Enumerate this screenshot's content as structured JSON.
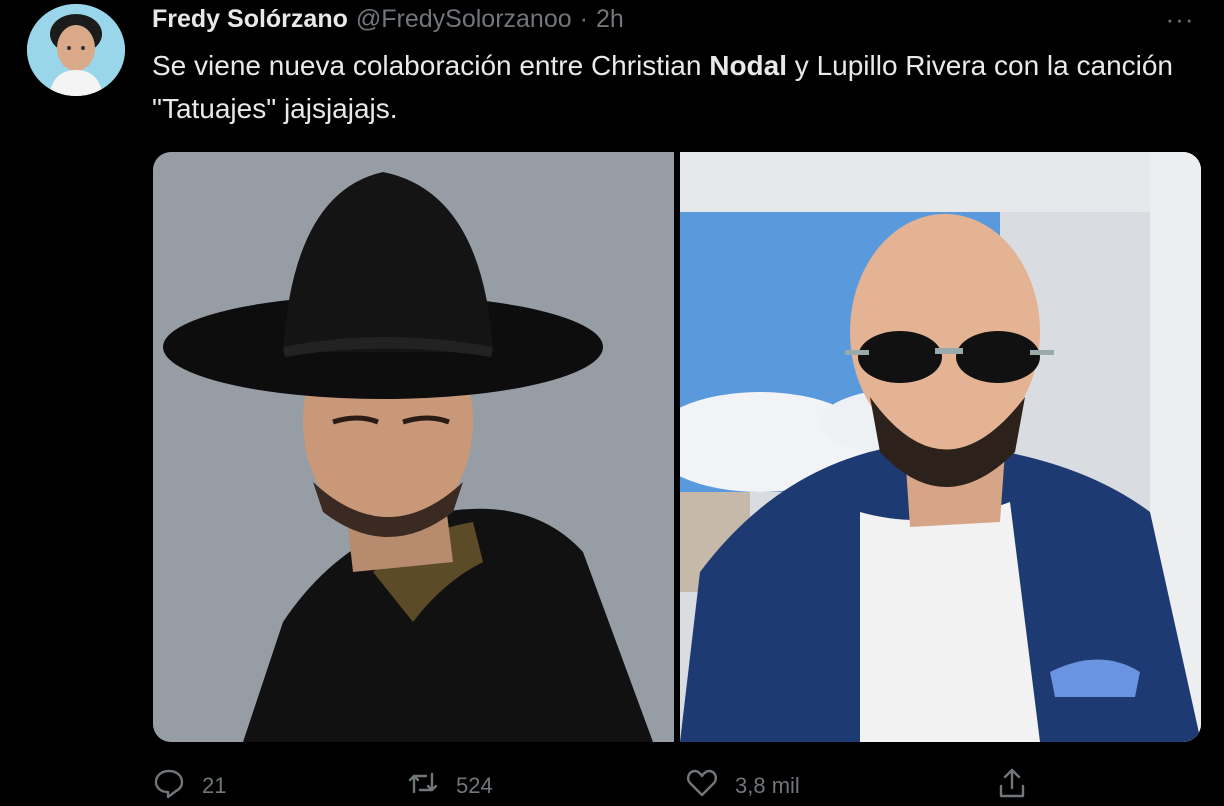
{
  "tweet": {
    "author_name": "Fredy Solórzano",
    "handle": "@FredySolorzanoo",
    "separator": "·",
    "time": "2h",
    "more_label": "···",
    "text_part1": "Se viene nueva colaboración entre Christian ",
    "text_bold": "Nodal",
    "text_part2": " y Lupillo Rivera con la canción \"Tatuajes\" jajsjajajs."
  },
  "actions": {
    "reply_count": "21",
    "retweet_count": "524",
    "like_count": "3,8 mil"
  },
  "icons": {
    "avatar": "avatar-image",
    "reply": "reply-icon",
    "retweet": "retweet-icon",
    "like": "heart-icon",
    "share": "share-icon",
    "more": "more-icon"
  },
  "colors": {
    "background": "#000000",
    "text": "#e7e9ea",
    "muted": "#71767b"
  }
}
